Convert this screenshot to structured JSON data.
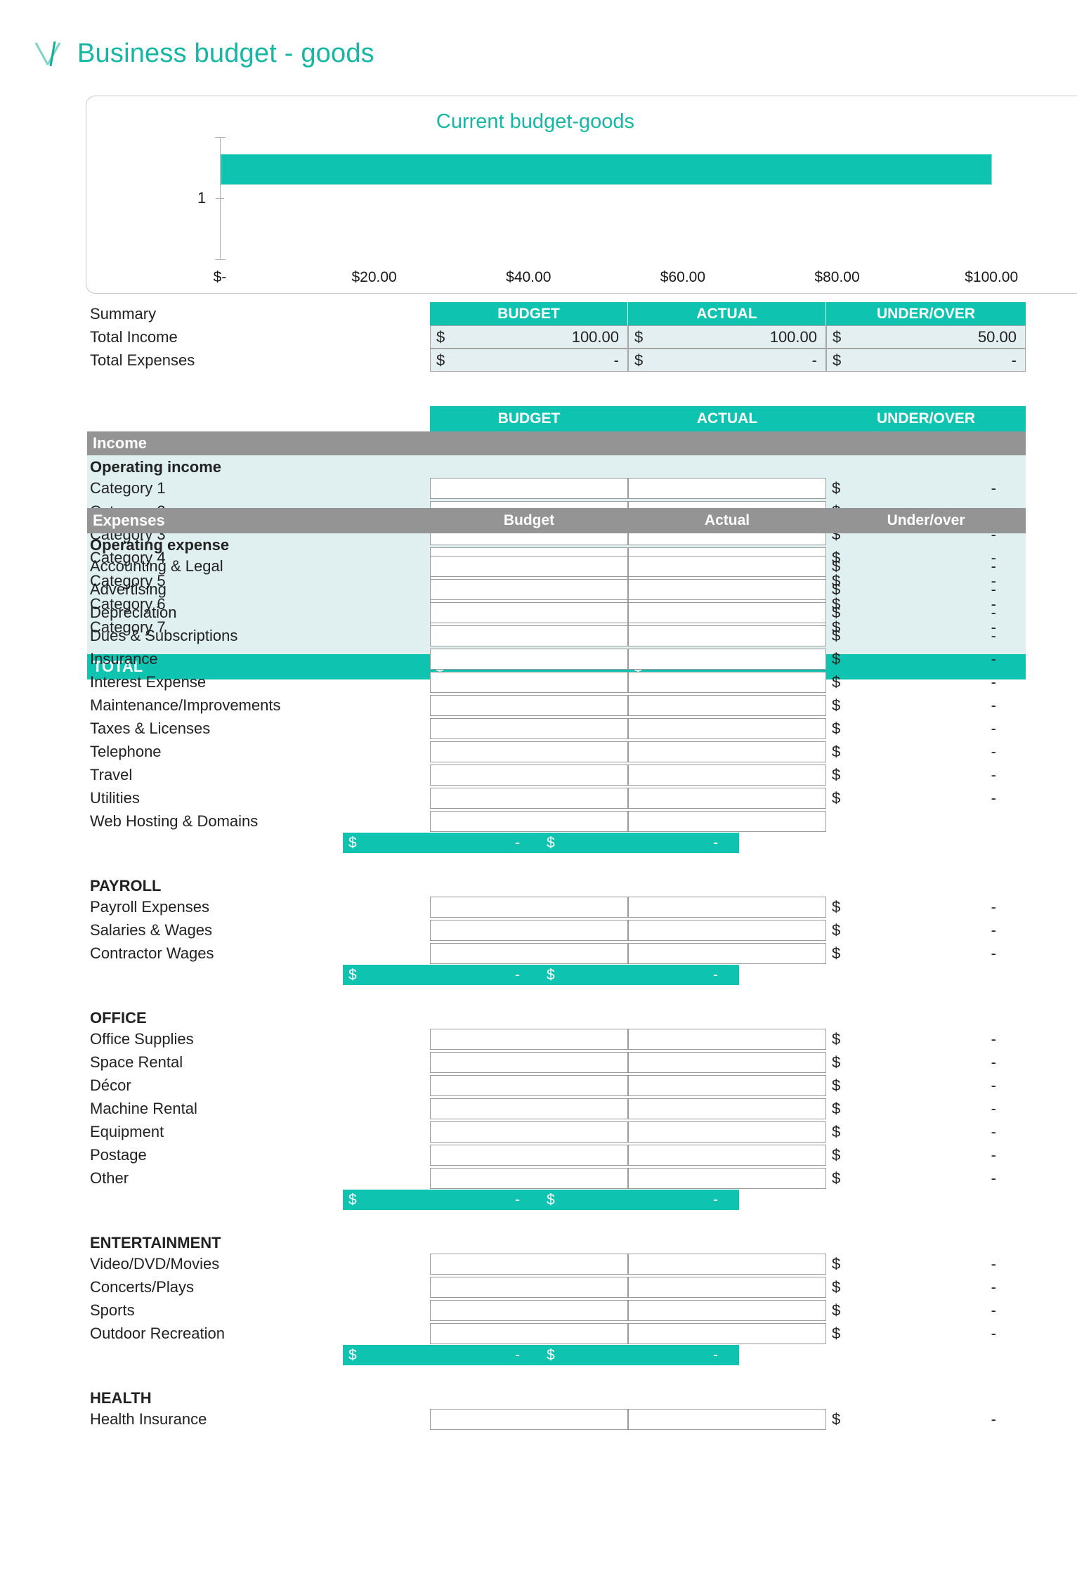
{
  "header": {
    "logo_icon": "vertex-v-logo-icon",
    "title": "Business budget - goods",
    "accent_color": "#0fc3b1",
    "title_color": "#15b7a4"
  },
  "chart_data": {
    "type": "bar",
    "orientation": "horizontal",
    "title": "Current budget-goods",
    "categories": [
      "1"
    ],
    "values": [
      100
    ],
    "series": [
      {
        "name": "Current budget-goods",
        "values": [
          100
        ],
        "color": "#0fc3b1"
      }
    ],
    "xlabel": "",
    "ylabel": "",
    "xlim": [
      0,
      110
    ],
    "x_tick_labels": [
      "$-",
      "$20.00",
      "$40.00",
      "$60.00",
      "$80.00",
      "$100.00"
    ],
    "x_tick_values": [
      0,
      20,
      40,
      60,
      80,
      100
    ],
    "y_tick_labels": [
      "1"
    ],
    "grid": false,
    "legend": "none"
  },
  "summary": {
    "label": "Summary",
    "columns": [
      "BUDGET",
      "ACTUAL",
      "UNDER/OVER"
    ],
    "rows": [
      {
        "label": "Total Income",
        "budget_sym": "$",
        "budget_val": "100.00",
        "actual_sym": "$",
        "actual_val": "100.00",
        "uo_sym": "$",
        "uo_val": "50.00"
      },
      {
        "label": "Total Expenses",
        "budget_sym": "$",
        "budget_val": "-",
        "actual_sym": "$",
        "actual_val": "-",
        "uo_sym": "$",
        "uo_val": "-"
      }
    ]
  },
  "income": {
    "columns": [
      "BUDGET",
      "ACTUAL",
      "UNDER/OVER"
    ],
    "section_label": "Income",
    "group_label": "Operating income",
    "items": [
      {
        "label": "Category 1",
        "uo_sym": "$",
        "uo_val": "-"
      },
      {
        "label": "Category 2",
        "uo_sym": "$",
        "uo_val": "-"
      },
      {
        "label": "Category 3",
        "uo_sym": "$",
        "uo_val": "-"
      },
      {
        "label": "Category 4",
        "uo_sym": "$",
        "uo_val": "-"
      },
      {
        "label": "Category 5",
        "uo_sym": "$",
        "uo_val": "-"
      },
      {
        "label": "Category 6",
        "uo_sym": "$",
        "uo_val": "-"
      },
      {
        "label": "Category 7",
        "uo_sym": "$",
        "uo_val": "-"
      }
    ],
    "total": {
      "label": "TOTAL",
      "budget_sym": "$",
      "budget_val": "-",
      "actual_sym": "$",
      "actual_val": "-"
    }
  },
  "expenses": {
    "section_label": "Expenses",
    "columns": [
      "Budget",
      "Actual",
      "Under/over"
    ],
    "groups": [
      {
        "group_label": "Operating expense",
        "items": [
          {
            "label": "Accounting & Legal",
            "uo_sym": "$",
            "uo_val": "-"
          },
          {
            "label": "Advertising",
            "uo_sym": "$",
            "uo_val": "-"
          },
          {
            "label": "Depreciation",
            "uo_sym": "$",
            "uo_val": "-"
          },
          {
            "label": "Dues & Subscriptions",
            "uo_sym": "$",
            "uo_val": "-"
          },
          {
            "label": "Insurance",
            "uo_sym": "$",
            "uo_val": "-"
          },
          {
            "label": "Interest Expense",
            "uo_sym": "$",
            "uo_val": "-"
          },
          {
            "label": "Maintenance/Improvements",
            "uo_sym": "$",
            "uo_val": "-"
          },
          {
            "label": "Taxes & Licenses",
            "uo_sym": "$",
            "uo_val": "-"
          },
          {
            "label": "Telephone",
            "uo_sym": "$",
            "uo_val": "-"
          },
          {
            "label": "Travel",
            "uo_sym": "$",
            "uo_val": "-"
          },
          {
            "label": "Utilities",
            "uo_sym": "$",
            "uo_val": "-"
          },
          {
            "label": "Web Hosting & Domains",
            "uo_sym": "",
            "uo_val": ""
          }
        ],
        "subtotal": {
          "budget_sym": "$",
          "budget_val": "-",
          "actual_sym": "$",
          "actual_val": "-"
        }
      },
      {
        "group_label": "PAYROLL",
        "items": [
          {
            "label": "Payroll Expenses",
            "uo_sym": "$",
            "uo_val": "-"
          },
          {
            "label": "Salaries & Wages",
            "uo_sym": "$",
            "uo_val": "-"
          },
          {
            "label": "Contractor Wages",
            "uo_sym": "$",
            "uo_val": "-"
          }
        ],
        "subtotal": {
          "budget_sym": "$",
          "budget_val": "-",
          "actual_sym": "$",
          "actual_val": "-"
        }
      },
      {
        "group_label": "OFFICE",
        "items": [
          {
            "label": "Office Supplies",
            "uo_sym": "$",
            "uo_val": "-"
          },
          {
            "label": "Space Rental",
            "uo_sym": "$",
            "uo_val": "-"
          },
          {
            "label": "Décor",
            "uo_sym": "$",
            "uo_val": "-"
          },
          {
            "label": "Machine Rental",
            "uo_sym": "$",
            "uo_val": "-"
          },
          {
            "label": "Equipment",
            "uo_sym": "$",
            "uo_val": "-"
          },
          {
            "label": "Postage",
            "uo_sym": "$",
            "uo_val": "-"
          },
          {
            "label": "Other",
            "uo_sym": "$",
            "uo_val": "-"
          }
        ],
        "subtotal": {
          "budget_sym": "$",
          "budget_val": "-",
          "actual_sym": "$",
          "actual_val": "-"
        }
      },
      {
        "group_label": "ENTERTAINMENT",
        "items": [
          {
            "label": "Video/DVD/Movies",
            "uo_sym": "$",
            "uo_val": "-"
          },
          {
            "label": "Concerts/Plays",
            "uo_sym": "$",
            "uo_val": "-"
          },
          {
            "label": "Sports",
            "uo_sym": "$",
            "uo_val": "-"
          },
          {
            "label": "Outdoor Recreation",
            "uo_sym": "$",
            "uo_val": "-"
          }
        ],
        "subtotal": {
          "budget_sym": "$",
          "budget_val": "-",
          "actual_sym": "$",
          "actual_val": "-"
        }
      },
      {
        "group_label": "HEALTH",
        "items": [
          {
            "label": "Health Insurance",
            "uo_sym": "$",
            "uo_val": "-"
          }
        ],
        "subtotal": null
      }
    ]
  }
}
